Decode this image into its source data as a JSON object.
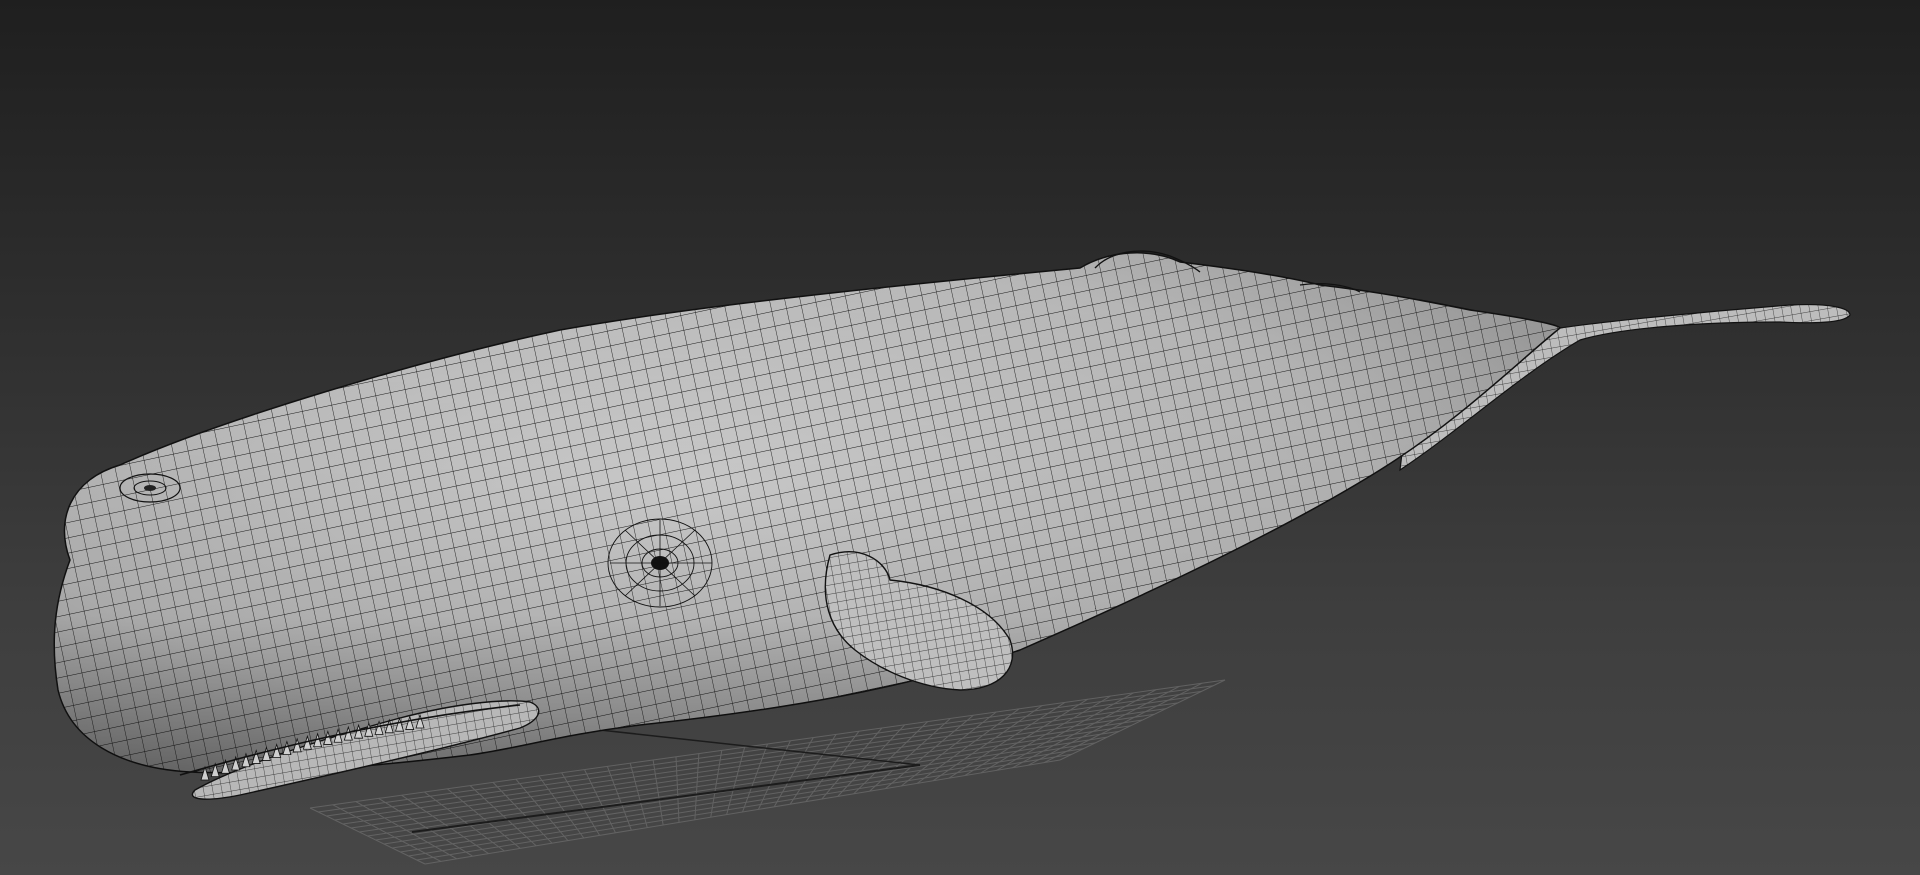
{
  "viewport": {
    "name": "perspective-viewport",
    "background_top": "#1f1f1f",
    "background_bottom": "#474747"
  },
  "scene": {
    "object": "sperm-whale-mesh",
    "display_mode": "shaded-with-wireframe",
    "mesh_color": "#c2c2c2",
    "wire_color": "#1a1a1a",
    "grid_color": "#6a6a6a",
    "grid_axis_color": "#1c1c1c"
  }
}
